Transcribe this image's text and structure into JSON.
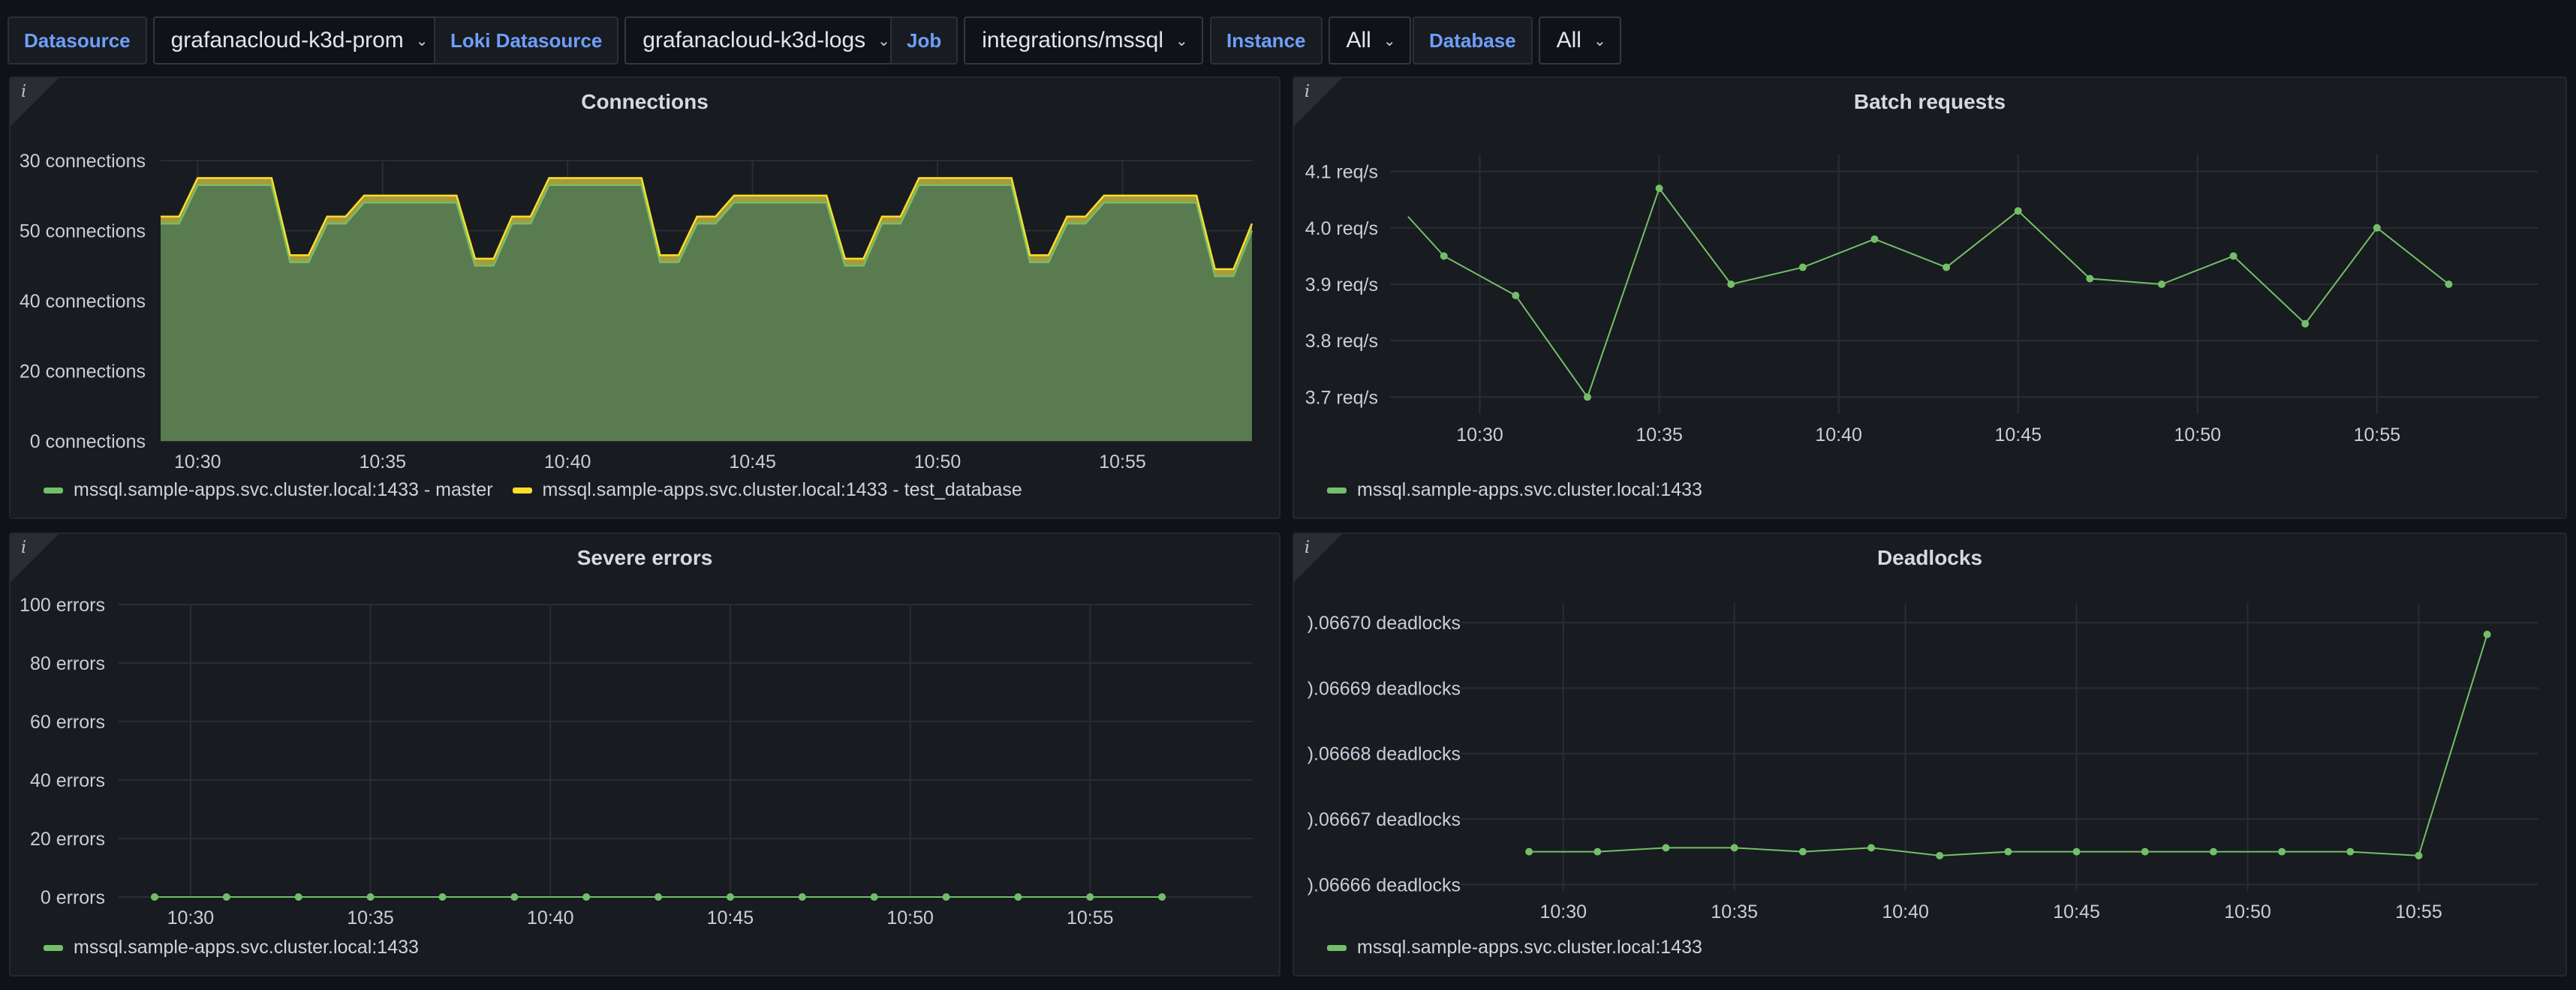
{
  "variables": [
    {
      "label": "Datasource",
      "value": "grafanacloud-k3d-prom"
    },
    {
      "label": "Loki Datasource",
      "value": "grafanacloud-k3d-logs"
    },
    {
      "label": "Job",
      "value": "integrations/mssql"
    },
    {
      "label": "Instance",
      "value": "All"
    },
    {
      "label": "Database",
      "value": "All"
    }
  ],
  "colors": {
    "green": "#73bf69",
    "yellow": "#fade2a",
    "accent": "#6e9fff"
  },
  "icons": {
    "info": "info-icon",
    "chevron": "chevron-down-icon"
  },
  "panels": {
    "connections": {
      "title": "Connections",
      "info": "i"
    },
    "batch": {
      "title": "Batch requests",
      "info": "i"
    },
    "severe": {
      "title": "Severe errors",
      "info": "i"
    },
    "deadlocks": {
      "title": "Deadlocks",
      "info": "i"
    }
  },
  "chart_data": [
    {
      "id": "connections",
      "type": "area",
      "stacked": true,
      "title": "Connections",
      "x": [
        "10:29",
        "10:29.5",
        "10:30",
        "10:32",
        "10:32.5",
        "10:33",
        "10:33.5",
        "10:34",
        "10:34.5",
        "10:37",
        "10:37.5",
        "10:38",
        "10:38.5",
        "10:39",
        "10:39.5",
        "10:42",
        "10:42.5",
        "10:43",
        "10:43.5",
        "10:44",
        "10:44.5",
        "10:47",
        "10:47.5",
        "10:48",
        "10:48.5",
        "10:49",
        "10:49.5",
        "10:52",
        "10:52.5",
        "10:53",
        "10:53.5",
        "10:54",
        "10:54.5",
        "10:57",
        "10:57.5",
        "10:58",
        "10:58.5"
      ],
      "xticks": [
        "10:30",
        "10:35",
        "10:40",
        "10:45",
        "10:50",
        "10:55"
      ],
      "yticks": [
        "0 connections",
        "20 connections",
        "40 connections",
        "50 connections",
        "30 connections"
      ],
      "series": [
        {
          "name": "mssql.sample-apps.svc.cluster.local:1433 - master",
          "color": "#73bf69",
          "values": [
            62,
            62,
            73,
            73,
            51,
            51,
            62,
            62,
            68,
            68,
            50,
            50,
            62,
            62,
            73,
            73,
            51,
            51,
            62,
            62,
            68,
            68,
            50,
            50,
            62,
            62,
            73,
            73,
            51,
            51,
            62,
            62,
            68,
            68,
            47,
            47,
            60
          ]
        },
        {
          "name": "mssql.sample-apps.svc.cluster.local:1433 - test_database",
          "color": "#fade2a",
          "values": [
            2,
            2,
            2,
            2,
            2,
            2,
            2,
            2,
            2,
            2,
            2,
            2,
            2,
            2,
            2,
            2,
            2,
            2,
            2,
            2,
            2,
            2,
            2,
            2,
            2,
            2,
            2,
            2,
            2,
            2,
            2,
            2,
            2,
            2,
            2,
            2,
            2
          ]
        }
      ],
      "ylim": [
        0,
        80
      ]
    },
    {
      "id": "batch",
      "type": "line",
      "title": "Batch requests",
      "x": [
        "10:28",
        "10:29",
        "10:31",
        "10:33",
        "10:35",
        "10:37",
        "10:39",
        "10:41",
        "10:43",
        "10:45",
        "10:47",
        "10:49",
        "10:51",
        "10:53",
        "10:55",
        "10:57"
      ],
      "xticks": [
        "10:30",
        "10:35",
        "10:40",
        "10:45",
        "10:50",
        "10:55"
      ],
      "yticks": [
        "3.7 req/s",
        "3.8 req/s",
        "3.9 req/s",
        "4.0 req/s",
        "4.1 req/s"
      ],
      "series": [
        {
          "name": "mssql.sample-apps.svc.cluster.local:1433",
          "color": "#73bf69",
          "values": [
            4.02,
            3.95,
            3.88,
            3.7,
            4.07,
            3.9,
            3.93,
            3.98,
            3.93,
            4.03,
            3.91,
            3.9,
            3.95,
            3.83,
            4.0,
            3.9
          ]
        }
      ],
      "ylim": [
        3.67,
        4.13
      ]
    },
    {
      "id": "severe",
      "type": "line",
      "title": "Severe errors",
      "x": [
        "10:29",
        "10:31",
        "10:33",
        "10:35",
        "10:37",
        "10:39",
        "10:41",
        "10:43",
        "10:45",
        "10:47",
        "10:49",
        "10:51",
        "10:53",
        "10:55",
        "10:57"
      ],
      "xticks": [
        "10:30",
        "10:35",
        "10:40",
        "10:45",
        "10:50",
        "10:55"
      ],
      "yticks": [
        "0 errors",
        "20 errors",
        "40 errors",
        "60 errors",
        "80 errors",
        "100 errors"
      ],
      "series": [
        {
          "name": "mssql.sample-apps.svc.cluster.local:1433",
          "color": "#73bf69",
          "values": [
            0,
            0,
            0,
            0,
            0,
            0,
            0,
            0,
            0,
            0,
            0,
            0,
            0,
            0,
            0
          ]
        }
      ],
      "ylim": [
        0,
        100
      ]
    },
    {
      "id": "deadlocks",
      "type": "line",
      "title": "Deadlocks",
      "x": [
        "10:29",
        "10:31",
        "10:33",
        "10:35",
        "10:37",
        "10:39",
        "10:41",
        "10:43",
        "10:45",
        "10:47",
        "10:49",
        "10:51",
        "10:53",
        "10:55",
        "10:57"
      ],
      "xticks": [
        "10:30",
        "10:35",
        "10:40",
        "10:45",
        "10:50",
        "10:55"
      ],
      "yticks": [
        ").06666 deadlocks",
        ").06667 deadlocks",
        ").06668 deadlocks",
        ").06669 deadlocks",
        ").06670 deadlocks"
      ],
      "series": [
        {
          "name": "mssql.sample-apps.svc.cluster.local:1433",
          "color": "#73bf69",
          "values": [
            0.066665,
            0.066665,
            0.0666656,
            0.0666656,
            0.066665,
            0.0666656,
            0.0666644,
            0.066665,
            0.066665,
            0.066665,
            0.066665,
            0.066665,
            0.066665,
            0.0666644,
            0.0666982
          ]
        }
      ],
      "ylim": [
        0.066659,
        0.066703
      ]
    }
  ]
}
